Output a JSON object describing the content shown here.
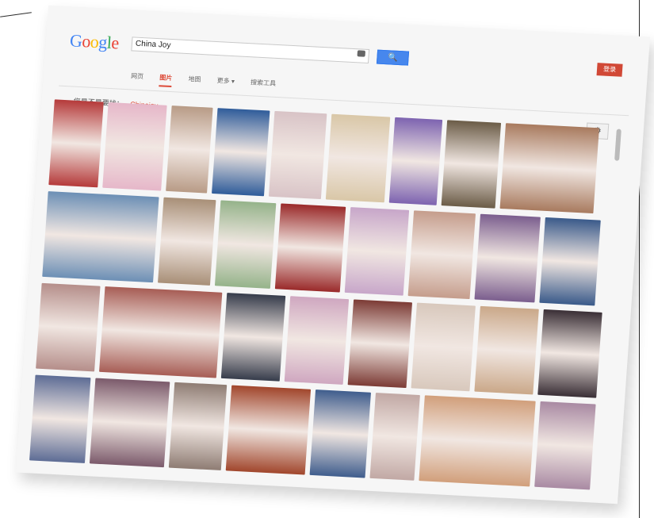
{
  "search": {
    "query": "China Joy",
    "button_label": "🔍"
  },
  "logo": {
    "letters": [
      "G",
      "o",
      "o",
      "g",
      "l",
      "e"
    ],
    "colors": [
      "#4285f4",
      "#ea4335",
      "#fbbc05",
      "#4285f4",
      "#34a853",
      "#ea4335"
    ]
  },
  "signin_label": "登录",
  "tabs": [
    {
      "label": "网页"
    },
    {
      "label": "图片",
      "active": true
    },
    {
      "label": "地图"
    },
    {
      "label": "更多 ▾"
    },
    {
      "label": "搜索工具"
    }
  ],
  "suggestion": {
    "prefix": "您是不是要找：",
    "term": "Chinajoy"
  },
  "icons": {
    "settings": "gear-icon",
    "camera": "camera-icon"
  },
  "colors": {
    "accent_red": "#dd4b39",
    "button_blue": "#4787ed"
  },
  "results": {
    "rows": [
      {
        "thumbs": [
          {
            "w": 62,
            "c": "#b53a3a"
          },
          {
            "w": 74,
            "c": "#e6b7c9"
          },
          {
            "w": 52,
            "c": "#b89b86"
          },
          {
            "w": 66,
            "c": "#2f5c9a"
          },
          {
            "w": 66,
            "c": "#d8c3c6"
          },
          {
            "w": 74,
            "c": "#d9c7a7"
          },
          {
            "w": 60,
            "c": "#7d63b0"
          },
          {
            "w": 68,
            "c": "#6b5c47"
          },
          {
            "w": 118,
            "c": "#a87a5e"
          }
        ]
      },
      {
        "thumbs": [
          {
            "w": 140,
            "c": "#6c8fb5"
          },
          {
            "w": 66,
            "c": "#a88f77"
          },
          {
            "w": 70,
            "c": "#95b38a"
          },
          {
            "w": 82,
            "c": "#9a2a2a"
          },
          {
            "w": 74,
            "c": "#c7a6c9"
          },
          {
            "w": 78,
            "c": "#c59d8c"
          },
          {
            "w": 76,
            "c": "#7b5e8e"
          },
          {
            "w": 70,
            "c": "#3a5a8a"
          }
        ]
      },
      {
        "thumbs": [
          {
            "w": 74,
            "c": "#b58e8a"
          },
          {
            "w": 148,
            "c": "#a75d55"
          },
          {
            "w": 74,
            "c": "#363c4b"
          },
          {
            "w": 74,
            "c": "#cfa7c0"
          },
          {
            "w": 74,
            "c": "#7c3b35"
          },
          {
            "w": 74,
            "c": "#d8c8bc"
          },
          {
            "w": 74,
            "c": "#caa889"
          },
          {
            "w": 74,
            "c": "#3a2f36"
          }
        ]
      },
      {
        "thumbs": [
          {
            "w": 70,
            "c": "#5d6c95"
          },
          {
            "w": 94,
            "c": "#7b5a6b"
          },
          {
            "w": 66,
            "c": "#8e7c73"
          },
          {
            "w": 100,
            "c": "#a1462c"
          },
          {
            "w": 70,
            "c": "#3f5d8d"
          },
          {
            "w": 56,
            "c": "#c1a8a4"
          },
          {
            "w": 140,
            "c": "#d19f7b"
          },
          {
            "w": 70,
            "c": "#a98aa3"
          }
        ]
      }
    ]
  }
}
